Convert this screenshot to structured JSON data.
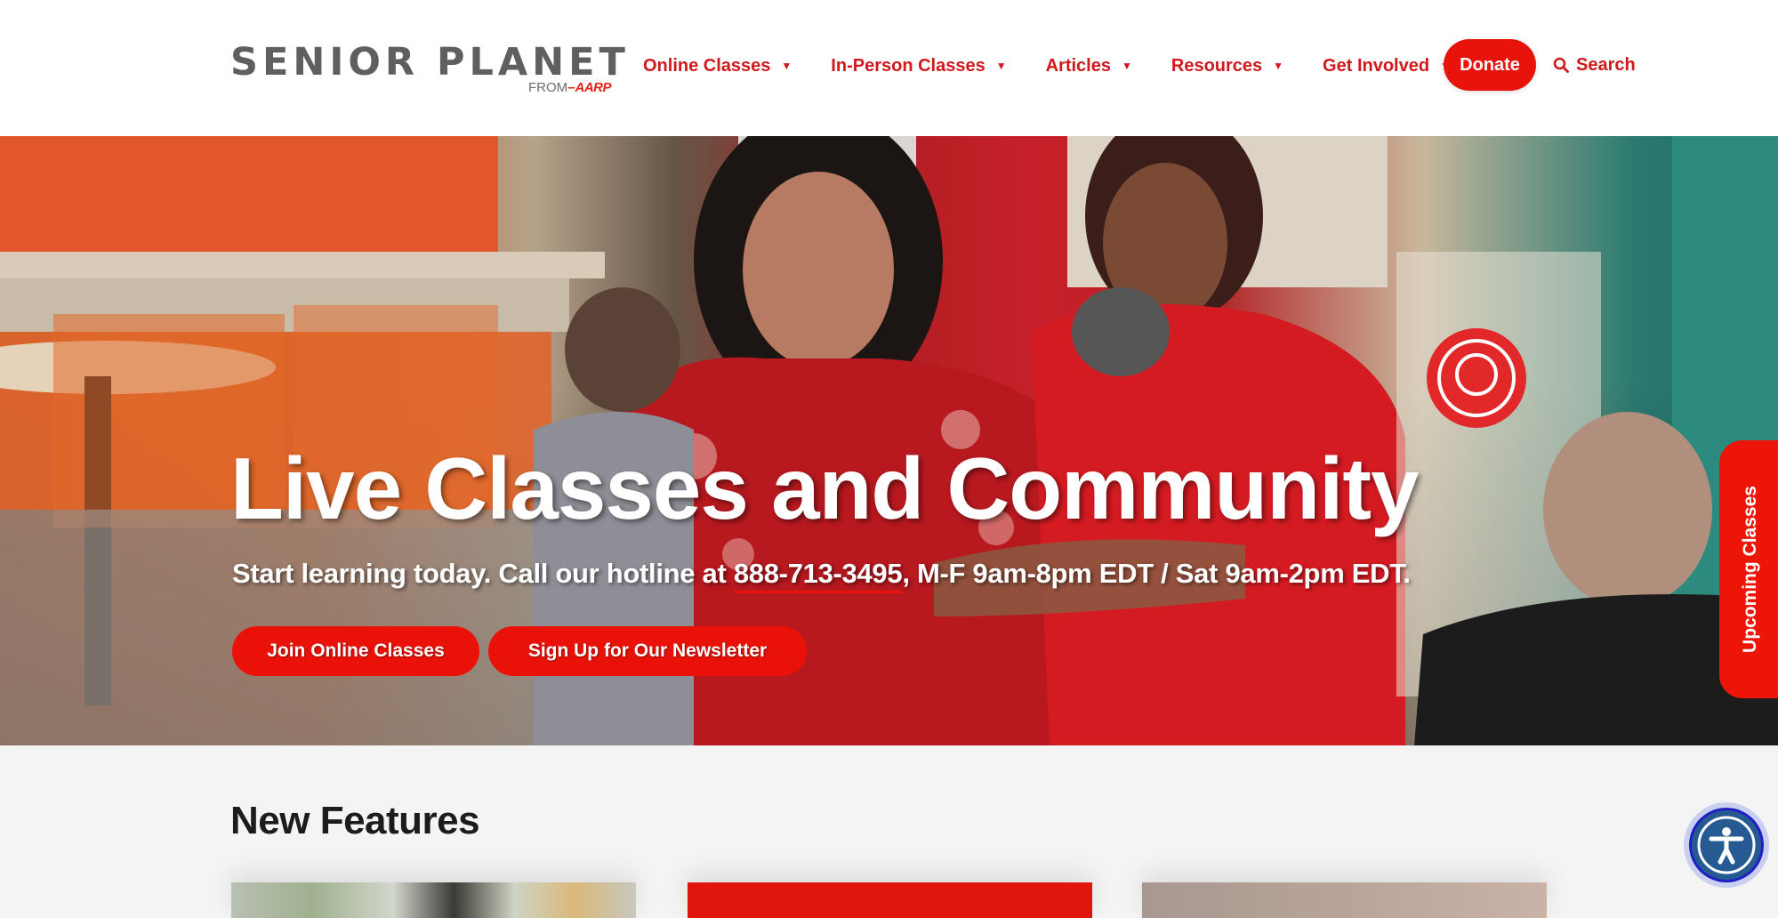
{
  "header": {
    "logo": {
      "name": "SENIOR PLANET",
      "from_label": "FROM",
      "partner": "AARP"
    },
    "nav": [
      {
        "label": "Online Classes",
        "icon": "caret-down-icon"
      },
      {
        "label": "In-Person Classes",
        "icon": "caret-down-icon"
      },
      {
        "label": "Articles",
        "icon": "caret-down-icon"
      },
      {
        "label": "Resources",
        "icon": "caret-down-icon"
      },
      {
        "label": "Get Involved",
        "icon": "caret-down-icon"
      }
    ],
    "donate_label": "Donate",
    "search_label": "Search",
    "search_icon": "search-icon"
  },
  "hero": {
    "title": "Live Classes and Community",
    "subtitle_prefix": "Start learning today. Call our hotline at ",
    "phone": "888-713-3495",
    "subtitle_suffix": ", M-F 9am-8pm EDT / Sat 9am-2pm EDT.",
    "buttons": [
      {
        "label": "Join Online Classes"
      },
      {
        "label": "Sign Up for Our Newsletter"
      }
    ],
    "side_tab_label": "Upcoming Classes"
  },
  "features": {
    "title": "New Features"
  },
  "accessibility": {
    "icon": "accessibility-icon"
  },
  "colors": {
    "brand_red": "#e8140c",
    "nav_red": "#d0191d",
    "logo_gray": "#5f5f5f",
    "accessibility_blue": "#265a92"
  }
}
